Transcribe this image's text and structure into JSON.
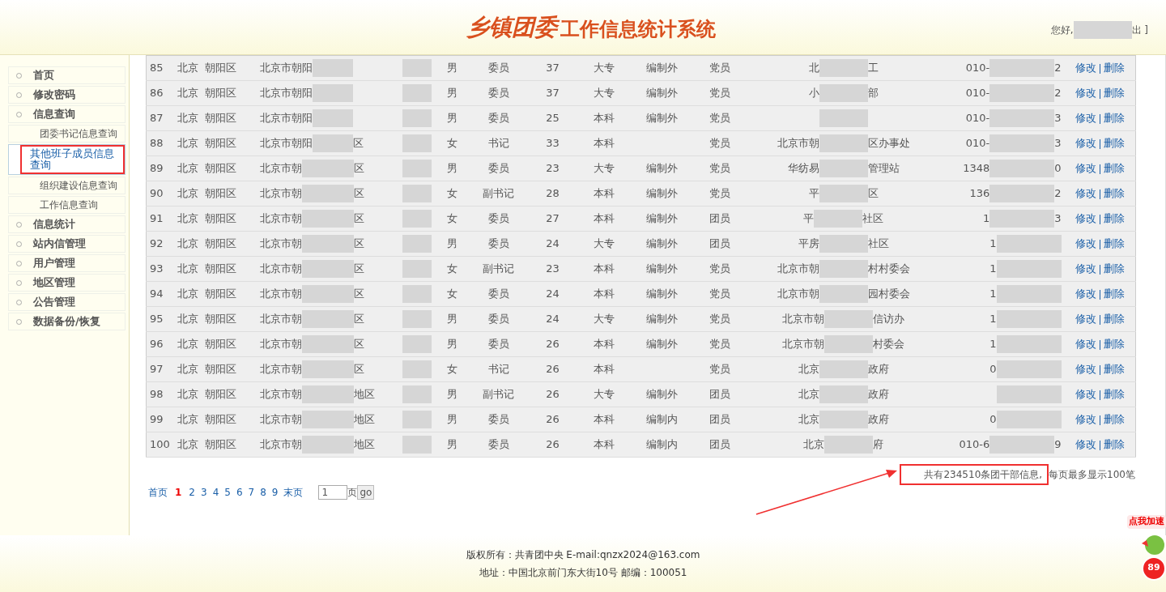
{
  "header": {
    "title_decorative": "乡镇团委",
    "title": "工作信息统计系统",
    "greeting": "您好,",
    "logout_fragment": "出 ]"
  },
  "sidebar": {
    "items": [
      {
        "kind": "main",
        "label": "首页",
        "selected": false
      },
      {
        "kind": "main",
        "label": "修改密码",
        "selected": false
      },
      {
        "kind": "main",
        "label": "信息查询",
        "selected": false
      },
      {
        "kind": "sub",
        "label": "团委书记信息查询",
        "selected": false
      },
      {
        "kind": "sub",
        "label": "其他班子成员信息查询",
        "selected": true,
        "highlighted": true
      },
      {
        "kind": "sub",
        "label": "组织建设信息查询",
        "selected": false
      },
      {
        "kind": "sub",
        "label": "工作信息查询",
        "selected": false
      },
      {
        "kind": "main",
        "label": "信息统计",
        "selected": false
      },
      {
        "kind": "main",
        "label": "站内信管理",
        "selected": false
      },
      {
        "kind": "main",
        "label": "用户管理",
        "selected": false
      },
      {
        "kind": "main",
        "label": "地区管理",
        "selected": false
      },
      {
        "kind": "main",
        "label": "公告管理",
        "selected": false
      },
      {
        "kind": "main",
        "label": "数据备份/恢复",
        "selected": false
      }
    ]
  },
  "table": {
    "rows": [
      {
        "no": "85",
        "province": "北京",
        "district": "朝阳区",
        "address": "北京市朝阳",
        "gender": "男",
        "post": "委员",
        "age": "37",
        "education": "大专",
        "staffing": "编制外",
        "politics": "党员",
        "unit_start": "北",
        "unit_end": "工",
        "phone_start": "010-",
        "phone_end": "2",
        "edit": "修改",
        "delete": "删除"
      },
      {
        "no": "86",
        "province": "北京",
        "district": "朝阳区",
        "address": "北京市朝阳",
        "gender": "男",
        "post": "委员",
        "age": "37",
        "education": "大专",
        "staffing": "编制外",
        "politics": "党员",
        "unit_start": "小",
        "unit_end": "部",
        "phone_start": "010-",
        "phone_end": "2",
        "edit": "修改",
        "delete": "删除"
      },
      {
        "no": "87",
        "province": "北京",
        "district": "朝阳区",
        "address": "北京市朝阳",
        "gender": "男",
        "post": "委员",
        "age": "25",
        "education": "本科",
        "staffing": "编制外",
        "politics": "党员",
        "phone_start": "010-",
        "phone_end": "3",
        "edit": "修改",
        "delete": "删除"
      },
      {
        "no": "88",
        "province": "北京",
        "district": "朝阳区",
        "address": "北京市朝阳",
        "address_end": "区",
        "gender": "女",
        "post": "书记",
        "age": "33",
        "education": "本科",
        "politics": "党员",
        "unit_start": "北京市朝",
        "unit_end": "区办事处",
        "phone_start": "010-",
        "phone_end": "3",
        "edit": "修改",
        "delete": "删除"
      },
      {
        "no": "89",
        "province": "北京",
        "district": "朝阳区",
        "address": "北京市朝",
        "address_end": "区",
        "gender": "男",
        "post": "委员",
        "age": "23",
        "education": "大专",
        "staffing": "编制外",
        "politics": "党员",
        "unit_start": "华纺易",
        "unit_end": "管理站",
        "phone_start": "1348",
        "phone_end": "0",
        "edit": "修改",
        "delete": "删除"
      },
      {
        "no": "90",
        "province": "北京",
        "district": "朝阳区",
        "address": "北京市朝",
        "address_end": "区",
        "gender": "女",
        "post": "副书记",
        "age": "28",
        "education": "本科",
        "staffing": "编制外",
        "politics": "党员",
        "unit_start": "平",
        "unit_end": "区",
        "phone_start": "136",
        "phone_end": "2",
        "edit": "修改",
        "delete": "删除"
      },
      {
        "no": "91",
        "province": "北京",
        "district": "朝阳区",
        "address": "北京市朝",
        "address_end": "区",
        "gender": "女",
        "post": "委员",
        "age": "27",
        "education": "本科",
        "staffing": "编制外",
        "politics": "团员",
        "unit_start": "平",
        "unit_end": "社区",
        "phone_start": "1",
        "phone_end": "3",
        "edit": "修改",
        "delete": "删除"
      },
      {
        "no": "92",
        "province": "北京",
        "district": "朝阳区",
        "address": "北京市朝",
        "address_end": "区",
        "gender": "男",
        "post": "委员",
        "age": "24",
        "education": "大专",
        "staffing": "编制外",
        "politics": "团员",
        "unit_start": "平房",
        "unit_end": "社区",
        "phone_start": "1",
        "edit": "修改",
        "delete": "删除"
      },
      {
        "no": "93",
        "province": "北京",
        "district": "朝阳区",
        "address": "北京市朝",
        "address_end": "区",
        "gender": "女",
        "post": "副书记",
        "age": "23",
        "education": "本科",
        "staffing": "编制外",
        "politics": "党员",
        "unit_start": "北京市朝",
        "unit_end": "村村委会",
        "phone_start": "1",
        "edit": "修改",
        "delete": "删除"
      },
      {
        "no": "94",
        "province": "北京",
        "district": "朝阳区",
        "address": "北京市朝",
        "address_end": "区",
        "gender": "女",
        "post": "委员",
        "age": "24",
        "education": "本科",
        "staffing": "编制外",
        "politics": "党员",
        "unit_start": "北京市朝",
        "unit_end": "园村委会",
        "phone_start": "1",
        "edit": "修改",
        "delete": "删除"
      },
      {
        "no": "95",
        "province": "北京",
        "district": "朝阳区",
        "address": "北京市朝",
        "address_end": "区",
        "gender": "男",
        "post": "委员",
        "age": "24",
        "education": "大专",
        "staffing": "编制外",
        "politics": "党员",
        "unit_start": "北京市朝",
        "unit_end": "信访办",
        "phone_start": "1",
        "edit": "修改",
        "delete": "删除"
      },
      {
        "no": "96",
        "province": "北京",
        "district": "朝阳区",
        "address": "北京市朝",
        "address_end": "区",
        "gender": "男",
        "post": "委员",
        "age": "26",
        "education": "本科",
        "staffing": "编制外",
        "politics": "党员",
        "unit_start": "北京市朝",
        "unit_end": "村委会",
        "phone_start": "1",
        "edit": "修改",
        "delete": "删除"
      },
      {
        "no": "97",
        "province": "北京",
        "district": "朝阳区",
        "address": "北京市朝",
        "address_end": "区",
        "gender": "女",
        "post": "书记",
        "age": "26",
        "education": "本科",
        "politics": "党员",
        "unit_start": "北京",
        "unit_end": "政府",
        "phone_start": "0",
        "edit": "修改",
        "delete": "删除"
      },
      {
        "no": "98",
        "province": "北京",
        "district": "朝阳区",
        "address": "北京市朝",
        "address_end": "地区",
        "gender": "男",
        "post": "副书记",
        "age": "26",
        "education": "大专",
        "staffing": "编制外",
        "politics": "团员",
        "unit_start": "北京",
        "unit_end": "政府",
        "edit": "修改",
        "delete": "删除"
      },
      {
        "no": "99",
        "province": "北京",
        "district": "朝阳区",
        "address": "北京市朝",
        "address_end": "地区",
        "gender": "男",
        "post": "委员",
        "age": "26",
        "education": "本科",
        "staffing": "编制内",
        "politics": "团员",
        "unit_start": "北京",
        "unit_end": "政府",
        "phone_start": "0",
        "edit": "修改",
        "delete": "删除"
      },
      {
        "no": "100",
        "province": "北京",
        "district": "朝阳区",
        "address": "北京市朝",
        "address_end": "地区",
        "gender": "男",
        "post": "委员",
        "age": "26",
        "education": "本科",
        "staffing": "编制内",
        "politics": "团员",
        "unit_start": "北京",
        "unit_end": "府",
        "phone_start": "010-6",
        "phone_end": "9",
        "edit": "修改",
        "delete": "删除"
      }
    ]
  },
  "pagination": {
    "first": "首页",
    "pages": [
      {
        "label": "1",
        "selected": true
      },
      {
        "label": "2",
        "selected": false
      },
      {
        "label": "3",
        "selected": false
      },
      {
        "label": "4",
        "selected": false
      },
      {
        "label": "5",
        "selected": false
      },
      {
        "label": "6",
        "selected": false
      },
      {
        "label": "7",
        "selected": false
      },
      {
        "label": "8",
        "selected": false
      },
      {
        "label": "9",
        "selected": false
      }
    ],
    "last": "末页",
    "page_input": "1",
    "page_unit": "页",
    "go": "go"
  },
  "summary": {
    "total": "共有234510条团干部信息,",
    "highlighted": true,
    "per_page": "每页最多显示100笔"
  },
  "footer": {
    "copyright": "版权所有：共青团中央 E-mail:qnzx2024@163.com",
    "address": "地址：中国北京前门东大街10号 邮编：100051"
  },
  "speed_widget": {
    "label": "点我加速",
    "count": "89"
  }
}
